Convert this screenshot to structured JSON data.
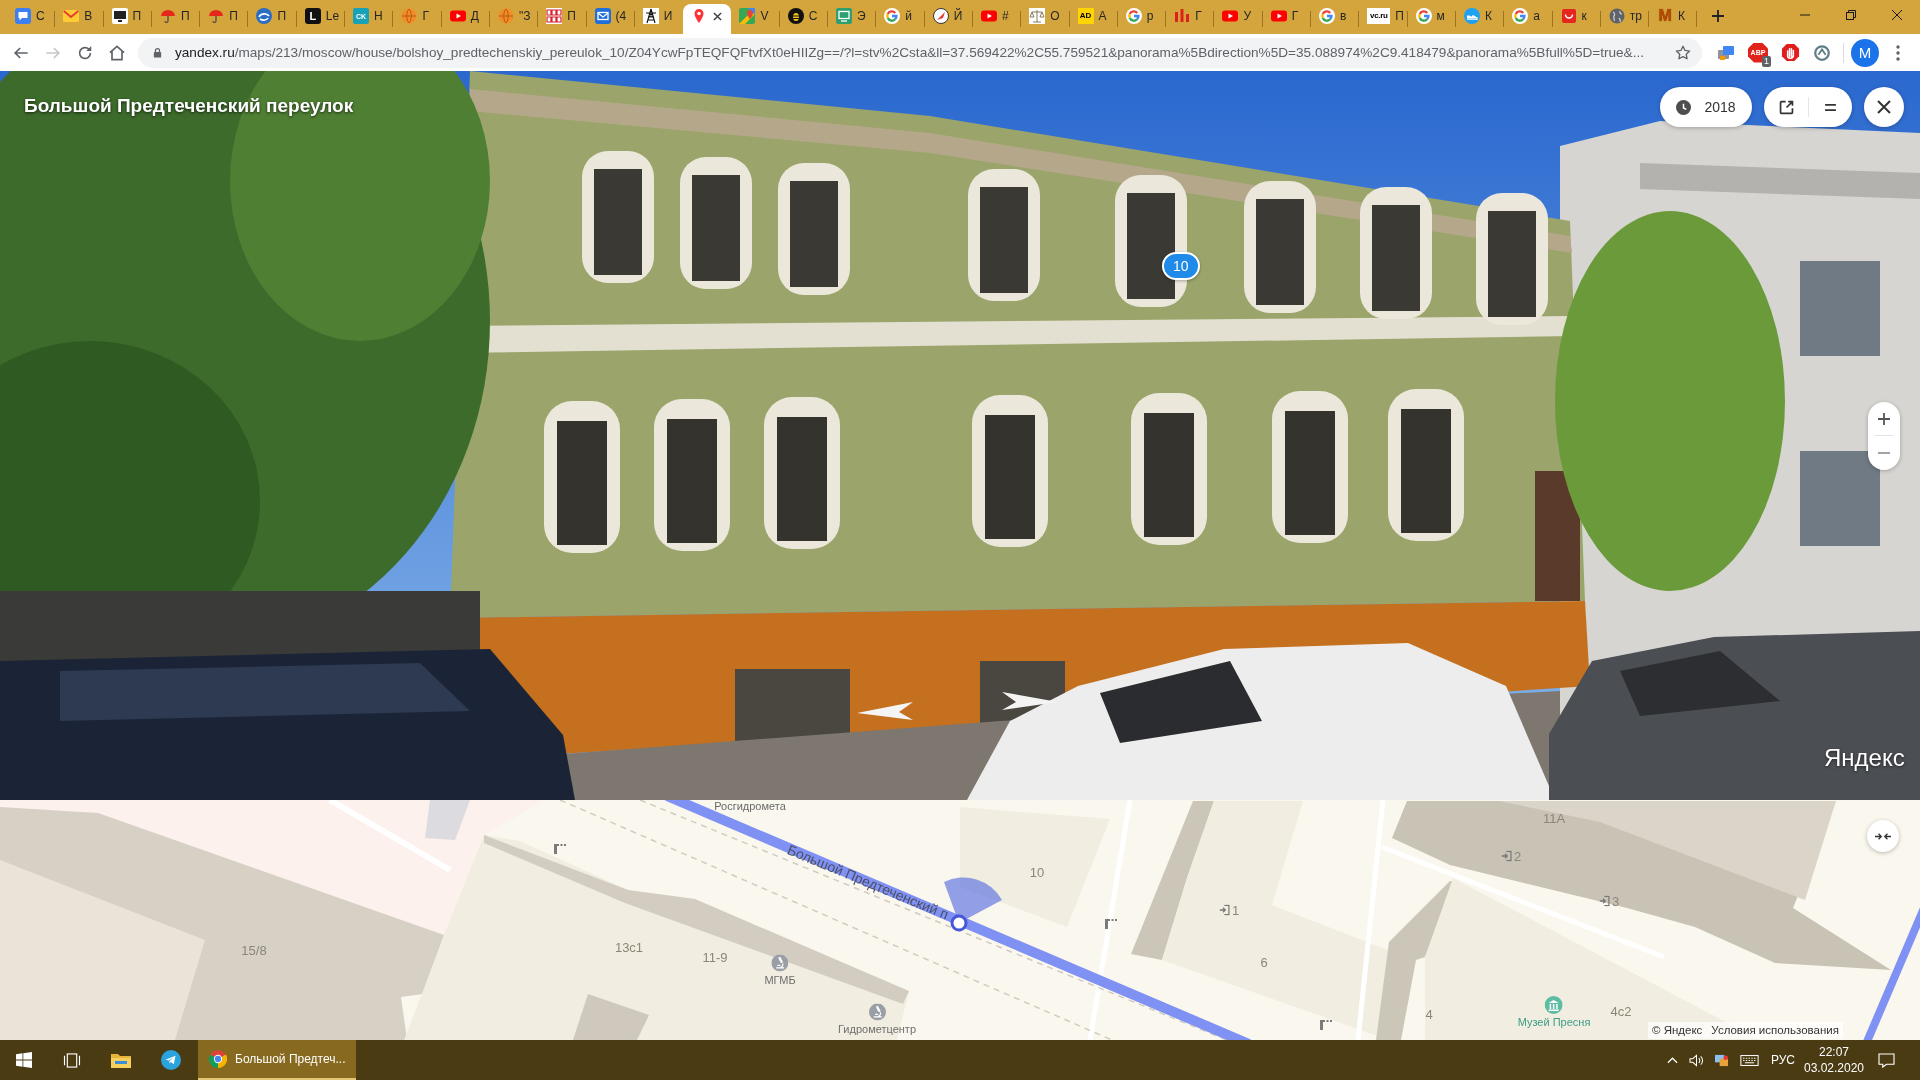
{
  "tabs": [
    {
      "kind": "chat",
      "title": "С",
      "selected": false
    },
    {
      "kind": "mail",
      "title": "В",
      "selected": false
    },
    {
      "kind": "monitor",
      "title": "П",
      "selected": false
    },
    {
      "kind": "umbrella",
      "title": "П",
      "selected": false
    },
    {
      "kind": "umbrella",
      "title": "П",
      "selected": false
    },
    {
      "kind": "swirl",
      "title": "П",
      "selected": false
    },
    {
      "kind": "darklogo",
      "logo": "L",
      "title": "Le",
      "selected": false
    },
    {
      "kind": "teallogo",
      "logo": "CK",
      "title": "Н",
      "selected": false
    },
    {
      "kind": "ball",
      "title": "Г",
      "selected": false
    },
    {
      "kind": "youtube",
      "title": "Д",
      "selected": false
    },
    {
      "kind": "ball",
      "title": "\"З",
      "selected": false
    },
    {
      "kind": "grid",
      "title": "П",
      "selected": false
    },
    {
      "kind": "envelope",
      "title": "(4",
      "selected": false
    },
    {
      "kind": "pylon",
      "title": "И",
      "selected": false
    },
    {
      "kind": "pin",
      "selected": true
    },
    {
      "kind": "maps",
      "title": "V",
      "selected": false
    },
    {
      "kind": "bee",
      "title": "С",
      "selected": false
    },
    {
      "kind": "screen",
      "title": "Э",
      "selected": false
    },
    {
      "kind": "google",
      "title": "й",
      "selected": false
    },
    {
      "kind": "compass",
      "title": "Й",
      "selected": false
    },
    {
      "kind": "youtube",
      "title": "#",
      "selected": false
    },
    {
      "kind": "scales",
      "title": "О",
      "selected": false
    },
    {
      "kind": "yellowlogo",
      "logo": "AD",
      "title": "А",
      "selected": false
    },
    {
      "kind": "google",
      "title": "р",
      "selected": false
    },
    {
      "kind": "bars",
      "title": "Г",
      "selected": false
    },
    {
      "kind": "youtube",
      "title": "У",
      "selected": false
    },
    {
      "kind": "youtube",
      "title": "Г",
      "selected": false
    },
    {
      "kind": "google",
      "title": "в",
      "selected": false
    },
    {
      "kind": "lightlogo",
      "logo": "vc.ru",
      "title": "П",
      "selected": false
    },
    {
      "kind": "google",
      "title": "м",
      "selected": false
    },
    {
      "kind": "shoe",
      "title": "К",
      "selected": false
    },
    {
      "kind": "google",
      "title": "а",
      "selected": false
    },
    {
      "kind": "smile",
      "title": "к",
      "selected": false
    },
    {
      "kind": "globe",
      "title": "тр",
      "selected": false
    },
    {
      "kind": "orangelogo",
      "logo": "M",
      "title": "К",
      "selected": false
    }
  ],
  "toolbar": {
    "nav": [
      {
        "kind": "back",
        "disabled": false
      },
      {
        "kind": "forward",
        "disabled": true
      },
      {
        "kind": "reload",
        "disabled": false
      },
      {
        "kind": "home",
        "disabled": false
      }
    ],
    "url_host": "yandex.ru",
    "url_path": "/maps/213/moscow/house/bolshoy_predtechenskiy_pereulok_10/Z04YcwFpTEQFQFtvfXt0eHIIZg==/?l=stv%2Csta&ll=37.569422%2C55.759521&panorama%5Bdirection%5D=35.088974%2C9.418479&panorama%5Bfull%5D=true&...",
    "extensions": [
      {
        "kind": "cards"
      },
      {
        "kind": "octagon",
        "logo": "ABP",
        "badge": "1"
      },
      {
        "kind": "hand"
      },
      {
        "kind": "ring"
      }
    ],
    "profile_initial": "M"
  },
  "panorama": {
    "title": "Большой Предтеченский переулок",
    "year": "2018",
    "house_number": "10",
    "logo": "Яндекс"
  },
  "map": {
    "labels": [
      {
        "kind": "street",
        "text": "Росгидромета"
      },
      {
        "kind": "street",
        "text": "Большой Предтеченский п"
      },
      {
        "kind": "building",
        "text": "15/8"
      },
      {
        "kind": "building",
        "text": "13с1"
      },
      {
        "kind": "building",
        "text": "11-9"
      },
      {
        "kind": "poi",
        "text": "МГМБ"
      },
      {
        "kind": "poi",
        "text": "Гидрометцентр"
      },
      {
        "kind": "building",
        "text": "10"
      },
      {
        "kind": "entrance",
        "text": "1"
      },
      {
        "kind": "building",
        "text": "6"
      },
      {
        "kind": "building",
        "text": "4"
      },
      {
        "kind": "building",
        "text": "11А"
      },
      {
        "kind": "entrance",
        "text": "2"
      },
      {
        "kind": "entrance",
        "text": "3"
      },
      {
        "kind": "museum",
        "text": "Музей Пресня"
      },
      {
        "kind": "building",
        "text": "4с2"
      }
    ],
    "attribution": [
      "© Яндекс",
      "Условия использования"
    ]
  },
  "taskbar": {
    "apps": [
      {
        "kind": "explorer",
        "selected": false
      },
      {
        "kind": "telegram",
        "selected": false
      },
      {
        "kind": "chrome",
        "title": "Большой Предтеч...",
        "selected": true
      }
    ],
    "language": "РУС",
    "time": "22:07",
    "date": "03.02.2020"
  }
}
